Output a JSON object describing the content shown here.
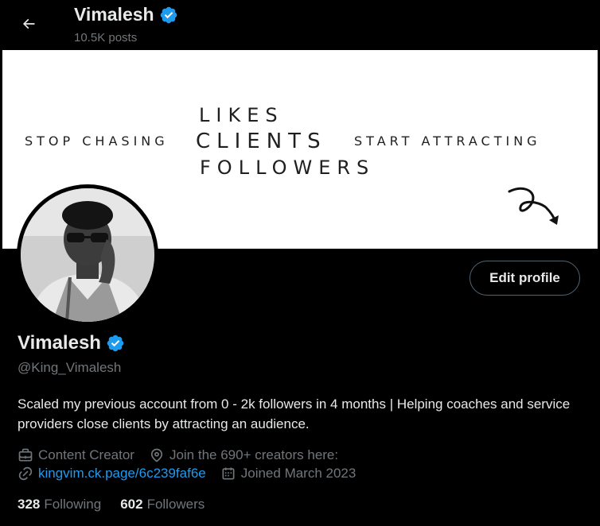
{
  "header": {
    "name": "Vimalesh",
    "posts": "10.5K posts"
  },
  "banner": {
    "left_text": "STOP CHASING",
    "stack_top": "LIKES",
    "stack_mid": "CLIENTS",
    "stack_bottom": "FOLLOWERS",
    "right_text": "START ATTRACTING"
  },
  "actions": {
    "edit_profile": "Edit profile"
  },
  "profile": {
    "name": "Vimalesh",
    "handle": "@King_Vimalesh",
    "bio": "Scaled my previous account from 0 - 2k followers in 4 months | Helping coaches and service providers close clients by attracting an audience.",
    "category": "Content Creator",
    "location": "Join the 690+ creators here:",
    "website": "kingvim.ck.page/6c239faf6e",
    "joined": "Joined March 2023"
  },
  "stats": {
    "following_count": "328",
    "following_label": "Following",
    "followers_count": "602",
    "followers_label": "Followers"
  },
  "colors": {
    "background": "#000000",
    "text_primary": "#e7e9ea",
    "text_secondary": "#71767b",
    "link": "#1d9bf0",
    "verified": "#1d9bf0"
  },
  "icons": [
    "back-arrow-icon",
    "verified-badge-icon",
    "briefcase-icon",
    "location-pin-icon",
    "link-icon",
    "calendar-icon",
    "curly-arrow-doodle"
  ]
}
